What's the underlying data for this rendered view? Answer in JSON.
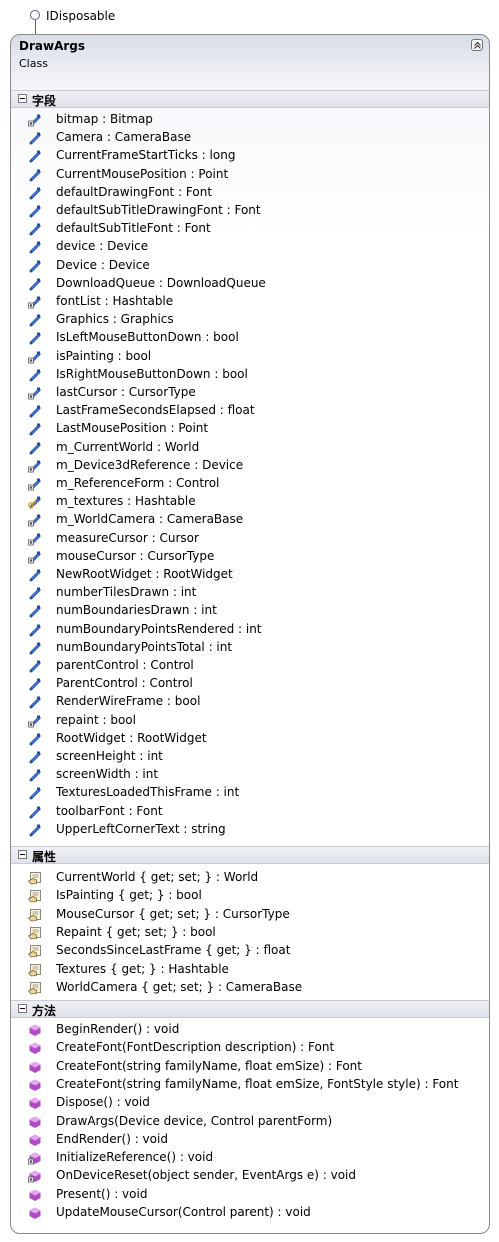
{
  "interface": {
    "label": "IDisposable"
  },
  "class": {
    "name": "DrawArgs",
    "stereotype": "Class"
  },
  "sections": [
    {
      "title": "字段",
      "kind": "field",
      "items": [
        {
          "text": "bitmap : Bitmap",
          "icon": "private-field-icon"
        },
        {
          "text": "Camera : CameraBase",
          "icon": "public-field-icon"
        },
        {
          "text": "CurrentFrameStartTicks : long",
          "icon": "public-field-icon"
        },
        {
          "text": "CurrentMousePosition : Point",
          "icon": "public-field-icon"
        },
        {
          "text": "defaultDrawingFont : Font",
          "icon": "public-field-icon"
        },
        {
          "text": "defaultSubTitleDrawingFont : Font",
          "icon": "public-field-icon"
        },
        {
          "text": "defaultSubTitleFont : Font",
          "icon": "public-field-icon"
        },
        {
          "text": "device : Device",
          "icon": "public-field-icon"
        },
        {
          "text": "Device : Device",
          "icon": "public-field-icon"
        },
        {
          "text": "DownloadQueue : DownloadQueue",
          "icon": "public-field-icon"
        },
        {
          "text": "fontList : Hashtable",
          "icon": "private-field-icon"
        },
        {
          "text": "Graphics : Graphics",
          "icon": "public-field-icon"
        },
        {
          "text": "IsLeftMouseButtonDown : bool",
          "icon": "public-field-icon"
        },
        {
          "text": "isPainting : bool",
          "icon": "private-field-icon"
        },
        {
          "text": "IsRightMouseButtonDown : bool",
          "icon": "public-field-icon"
        },
        {
          "text": "lastCursor : CursorType",
          "icon": "private-field-icon"
        },
        {
          "text": "LastFrameSecondsElapsed : float",
          "icon": "public-field-icon"
        },
        {
          "text": "LastMousePosition : Point",
          "icon": "public-field-icon"
        },
        {
          "text": "m_CurrentWorld : World",
          "icon": "public-field-icon"
        },
        {
          "text": "m_Device3dReference : Device",
          "icon": "private-field-icon"
        },
        {
          "text": "m_ReferenceForm : Control",
          "icon": "private-field-icon"
        },
        {
          "text": "m_textures : Hashtable",
          "icon": "protected-field-icon"
        },
        {
          "text": "m_WorldCamera : CameraBase",
          "icon": "private-field-icon"
        },
        {
          "text": "measureCursor : Cursor",
          "icon": "private-field-icon"
        },
        {
          "text": "mouseCursor : CursorType",
          "icon": "private-field-icon"
        },
        {
          "text": "NewRootWidget : RootWidget",
          "icon": "public-field-icon"
        },
        {
          "text": "numberTilesDrawn : int",
          "icon": "public-field-icon"
        },
        {
          "text": "numBoundariesDrawn : int",
          "icon": "public-field-icon"
        },
        {
          "text": "numBoundaryPointsRendered : int",
          "icon": "public-field-icon"
        },
        {
          "text": "numBoundaryPointsTotal : int",
          "icon": "public-field-icon"
        },
        {
          "text": "parentControl : Control",
          "icon": "public-field-icon"
        },
        {
          "text": "ParentControl : Control",
          "icon": "public-field-icon"
        },
        {
          "text": "RenderWireFrame : bool",
          "icon": "public-field-icon"
        },
        {
          "text": "repaint : bool",
          "icon": "private-field-icon"
        },
        {
          "text": "RootWidget : RootWidget",
          "icon": "public-field-icon"
        },
        {
          "text": "screenHeight : int",
          "icon": "public-field-icon"
        },
        {
          "text": "screenWidth : int",
          "icon": "public-field-icon"
        },
        {
          "text": "TexturesLoadedThisFrame : int",
          "icon": "public-field-icon"
        },
        {
          "text": "toolbarFont : Font",
          "icon": "public-field-icon"
        },
        {
          "text": "UpperLeftCornerText : string",
          "icon": "public-field-icon"
        }
      ]
    },
    {
      "title": "属性",
      "kind": "property",
      "items": [
        {
          "text": "CurrentWorld { get; set; } : World",
          "icon": "property-icon"
        },
        {
          "text": "IsPainting { get; } : bool",
          "icon": "property-icon"
        },
        {
          "text": "MouseCursor { get; set; } : CursorType",
          "icon": "property-icon"
        },
        {
          "text": "Repaint { get; set; } : bool",
          "icon": "property-icon"
        },
        {
          "text": "SecondsSinceLastFrame { get; } : float",
          "icon": "property-icon"
        },
        {
          "text": "Textures { get; } : Hashtable",
          "icon": "property-icon"
        },
        {
          "text": "WorldCamera { get; set; } : CameraBase",
          "icon": "property-icon"
        }
      ]
    },
    {
      "title": "方法",
      "kind": "method",
      "items": [
        {
          "text": "BeginRender() : void",
          "icon": "public-method-icon"
        },
        {
          "text": "CreateFont(FontDescription description) : Font",
          "icon": "public-method-icon"
        },
        {
          "text": "CreateFont(string familyName, float emSize) : Font",
          "icon": "public-method-icon"
        },
        {
          "text": "CreateFont(string familyName, float emSize, FontStyle style) : Font",
          "icon": "public-method-icon"
        },
        {
          "text": "Dispose() : void",
          "icon": "public-method-icon"
        },
        {
          "text": "DrawArgs(Device device, Control parentForm)",
          "icon": "public-method-icon"
        },
        {
          "text": "EndRender() : void",
          "icon": "public-method-icon"
        },
        {
          "text": "InitializeReference() : void",
          "icon": "private-method-icon"
        },
        {
          "text": "OnDeviceReset(object sender, EventArgs e) : void",
          "icon": "private-method-icon"
        },
        {
          "text": "Present() : void",
          "icon": "public-method-icon"
        },
        {
          "text": "UpdateMouseCursor(Control parent) : void",
          "icon": "public-method-icon"
        }
      ]
    }
  ],
  "colors": {
    "field": "#1f4fa8",
    "field_light": "#5d86d6",
    "protected_key": "#d6a21e",
    "property_card": "#fbf3d0",
    "property_hand": "#7a6a3a",
    "method": "#b04bc6",
    "method_light": "#e5a8f0"
  }
}
